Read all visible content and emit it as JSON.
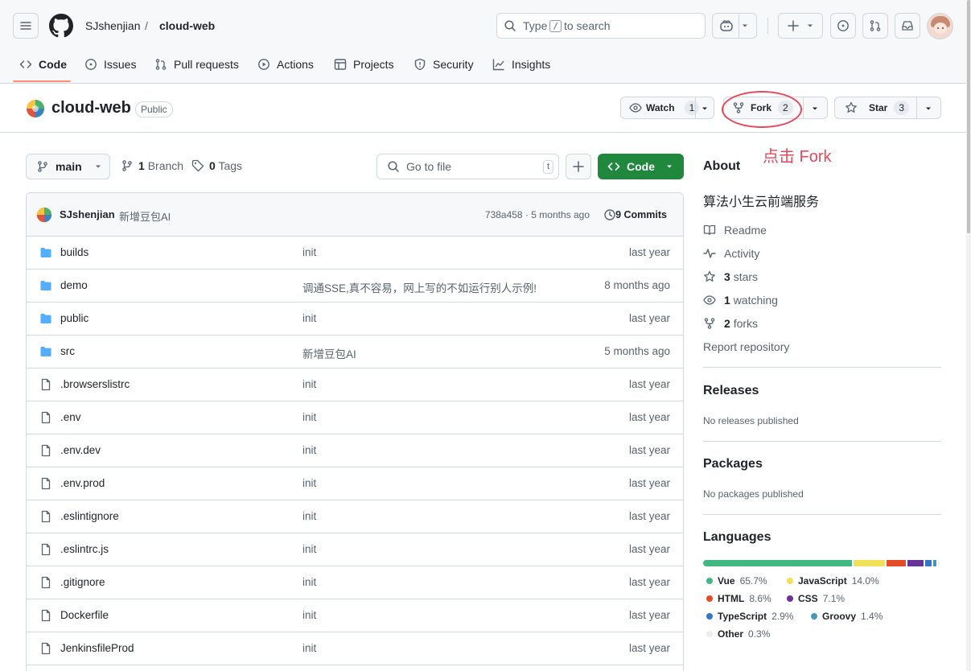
{
  "header": {
    "owner": "SJshenjian",
    "separator": "/",
    "repo": "cloud-web",
    "search": {
      "prefix": "Type",
      "key": "/",
      "suffix": "to search"
    }
  },
  "tabs": [
    {
      "label": "Code",
      "icon": "code-icon",
      "selected": true
    },
    {
      "label": "Issues",
      "icon": "issue-icon"
    },
    {
      "label": "Pull requests",
      "icon": "pull-request-icon"
    },
    {
      "label": "Actions",
      "icon": "play-icon"
    },
    {
      "label": "Projects",
      "icon": "table-icon"
    },
    {
      "label": "Security",
      "icon": "shield-icon"
    },
    {
      "label": "Insights",
      "icon": "graph-icon"
    }
  ],
  "repo": {
    "name": "cloud-web",
    "visibility": "Public",
    "watch": {
      "label": "Watch",
      "count": "1"
    },
    "fork": {
      "label": "Fork",
      "count": "2"
    },
    "star": {
      "label": "Star",
      "count": "3"
    }
  },
  "annotation": {
    "text": "点击 Fork",
    "color": "#e5495b"
  },
  "nav": {
    "branch": "main",
    "branches_count": "1",
    "branches_label": "Branch",
    "tags_count": "0",
    "tags_label": "Tags",
    "gofile_placeholder": "Go to file",
    "gofile_key": "t",
    "code_label": "Code"
  },
  "commit": {
    "author": "SJshenjian",
    "message": "新增豆包AI",
    "hash_time": "738a458 · 5 months ago",
    "commits_label": "9 Commits"
  },
  "files": [
    {
      "name": "builds",
      "type": "folder",
      "message": "init",
      "date": "last year"
    },
    {
      "name": "demo",
      "type": "folder",
      "message": "调通SSE,真不容易，网上写的不如运行别人示例!",
      "date": "8 months ago"
    },
    {
      "name": "public",
      "type": "folder",
      "message": "init",
      "date": "last year"
    },
    {
      "name": "src",
      "type": "folder",
      "message": "新增豆包AI",
      "date": "5 months ago"
    },
    {
      "name": ".browserslistrc",
      "type": "file",
      "message": "init",
      "date": "last year"
    },
    {
      "name": ".env",
      "type": "file",
      "message": "init",
      "date": "last year"
    },
    {
      "name": ".env.dev",
      "type": "file",
      "message": "init",
      "date": "last year"
    },
    {
      "name": ".env.prod",
      "type": "file",
      "message": "init",
      "date": "last year"
    },
    {
      "name": ".eslintignore",
      "type": "file",
      "message": "init",
      "date": "last year"
    },
    {
      "name": ".eslintrc.js",
      "type": "file",
      "message": "init",
      "date": "last year"
    },
    {
      "name": ".gitignore",
      "type": "file",
      "message": "init",
      "date": "last year"
    },
    {
      "name": "Dockerfile",
      "type": "file",
      "message": "init",
      "date": "last year"
    },
    {
      "name": "JenkinsfileProd",
      "type": "file",
      "message": "init",
      "date": "last year"
    }
  ],
  "about": {
    "heading": "About",
    "description": "算法小生云前端服务",
    "readme": "Readme",
    "activity": "Activity",
    "stars_count": "3",
    "stars_label": "stars",
    "watching_count": "1",
    "watching_label": "watching",
    "forks_count": "2",
    "forks_label": "forks",
    "report": "Report repository"
  },
  "releases": {
    "heading": "Releases",
    "text": "No releases published"
  },
  "packages": {
    "heading": "Packages",
    "text": "No packages published"
  },
  "languages": {
    "heading": "Languages",
    "items": [
      {
        "name": "Vue",
        "percent": "65.7%",
        "value": 65.7,
        "color": "#41b883"
      },
      {
        "name": "JavaScript",
        "percent": "14.0%",
        "value": 14.0,
        "color": "#f1e05a"
      },
      {
        "name": "HTML",
        "percent": "8.6%",
        "value": 8.6,
        "color": "#e34c26"
      },
      {
        "name": "CSS",
        "percent": "7.1%",
        "value": 7.1,
        "color": "#663399"
      },
      {
        "name": "TypeScript",
        "percent": "2.9%",
        "value": 2.9,
        "color": "#3178c6"
      },
      {
        "name": "Groovy",
        "percent": "1.4%",
        "value": 1.4,
        "color": "#4298b8"
      },
      {
        "name": "Other",
        "percent": "0.3%",
        "value": 0.3,
        "color": "#ededed"
      }
    ]
  }
}
